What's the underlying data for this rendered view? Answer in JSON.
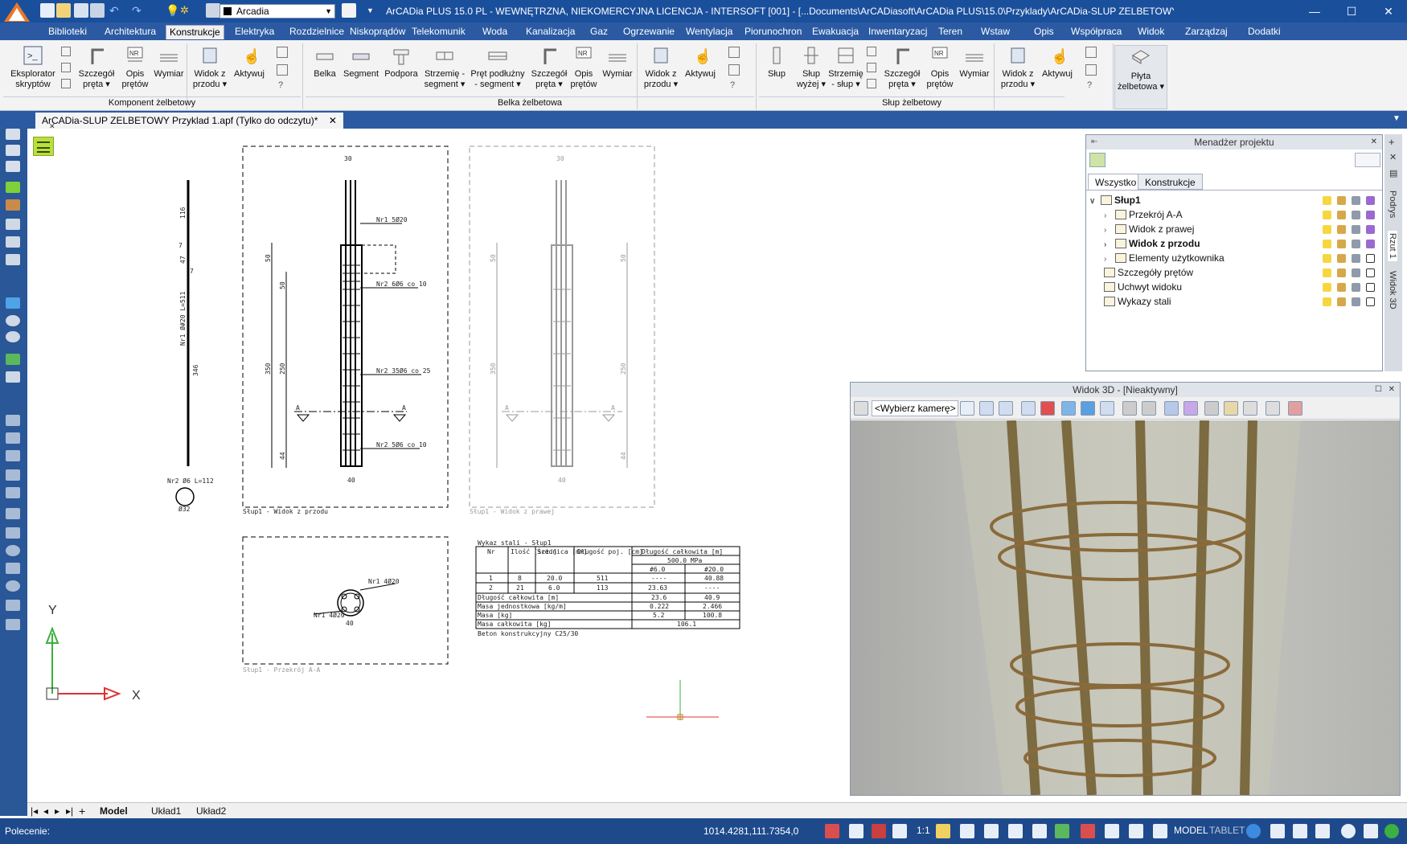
{
  "titlebar": {
    "title": "ArCADia PLUS 15.0 PL - WEWNĘTRZNA, NIEKOMERCYJNA LICENCJA - INTERSOFT [001] - [...Documents\\ArCADiasoft\\ArCADia PLUS\\15.0\\Przyklady\\ArCADia-SLUP ZELBETOWY Prz]",
    "font_name": "Arcadia",
    "minimize": "—",
    "maximize": "☐",
    "close": "✕"
  },
  "menu": [
    "Biblioteki",
    "Architektura",
    "Konstrukcje",
    "Elektryka",
    "Rozdzielnice",
    "Niskoprądów",
    "Telekomunik",
    "Woda",
    "Kanalizacja",
    "Gaz",
    "Ogrzewanie",
    "Wentylacja",
    "Piorunochron",
    "Ewakuacja",
    "Inwentaryzacj",
    "Teren",
    "Wstaw",
    "Opis",
    "Współpraca",
    "Widok",
    "Zarządzaj",
    "Dodatki"
  ],
  "ribbon": {
    "group1": {
      "title": "Komponent żelbetowy",
      "buttons": [
        [
          "Eksplorator",
          "skryptów"
        ],
        [
          "Szczegół",
          "pręta ▾"
        ],
        [
          "Opis",
          "prętów"
        ],
        [
          "Wymiar",
          ""
        ],
        [
          "Widok z",
          "przodu ▾"
        ],
        [
          "Aktywuj",
          ""
        ]
      ]
    },
    "group2": {
      "title": "Belka żelbetowa",
      "buttons": [
        [
          "Belka",
          ""
        ],
        [
          "Segment",
          ""
        ],
        [
          "Podpora",
          ""
        ],
        [
          "Strzemię -",
          "segment ▾"
        ],
        [
          "Pręt podłużny",
          "- segment ▾"
        ],
        [
          "Szczegół",
          "pręta ▾"
        ],
        [
          "Opis",
          "prętów"
        ],
        [
          "Wymiar",
          ""
        ],
        [
          "Widok z",
          "przodu ▾"
        ],
        [
          "Aktywuj",
          ""
        ]
      ]
    },
    "group3": {
      "title": "Słup żelbetowy",
      "buttons": [
        [
          "Słup",
          ""
        ],
        [
          "Słup",
          "wyżej ▾"
        ],
        [
          "Strzemię",
          "- słup ▾"
        ],
        [
          "Szczegół",
          "pręta ▾"
        ],
        [
          "Opis",
          "prętów"
        ],
        [
          "Wymiar",
          ""
        ],
        [
          "Widok z",
          "przodu ▾"
        ],
        [
          "Aktywuj",
          ""
        ]
      ]
    },
    "group4": {
      "buttons": [
        [
          "Płyta",
          "żelbetowa ▾"
        ]
      ]
    },
    "help": "?"
  },
  "doc_tab": "ArCADia-SLUP ZELBETOWY Przyklad 1.apf (Tylko do odczytu)*",
  "doc_close": "✕",
  "doc_add": "+",
  "project_manager": {
    "title": "Menadżer projektu",
    "close": "✕",
    "tabs": [
      "Wszystko",
      "Konstrukcje"
    ],
    "tree": [
      {
        "label": "Słup1",
        "level": 0,
        "bold": true,
        "arrow": "∨"
      },
      {
        "label": "Przekrój A-A",
        "level": 1,
        "bold": false,
        "arrow": "›"
      },
      {
        "label": "Widok z prawej",
        "level": 1,
        "bold": false,
        "arrow": "›"
      },
      {
        "label": "Widok z przodu",
        "level": 1,
        "bold": true,
        "arrow": "›"
      },
      {
        "label": "Elementy użytkownika",
        "level": 1,
        "bold": false,
        "arrow": "›"
      },
      {
        "label": "Szczegóły prętów",
        "level": 0,
        "bold": false,
        "arrow": ""
      },
      {
        "label": "Uchwyt widoku",
        "level": 0,
        "bold": false,
        "arrow": ""
      },
      {
        "label": "Wykazy stali",
        "level": 0,
        "bold": false,
        "arrow": ""
      }
    ]
  },
  "side_tabs": [
    "Podrys",
    "Rzut 1",
    "Widok 3D"
  ],
  "view3d": {
    "title": "Widok 3D - [Nieaktywny]",
    "camera": "<Wybierz kamerę>",
    "max": "☐",
    "close": "✕"
  },
  "drawing": {
    "front_view_caption": "Słup1 - Widok z przodu",
    "right_view_caption": "Słup1 - Widok z prawej",
    "section_caption": "Słup1 - Przekrój A-A",
    "bar1_label": "Nr1 5Ø20",
    "bar2a_label": "Nr2 6Ø6 co 10",
    "bar2b_label": "Nr2 35Ø6 co 25",
    "bar2c_label": "Nr2 5Ø6 co 10",
    "long_bar_label": "Nr1 Ø#20 L=511",
    "stirrup_label": "Nr2 Ø6 L=112",
    "stirrup_dim": "Ø32",
    "sec_bar1": "Nr1 4Ø20",
    "sec_bar2": "Nr1 4Ø20",
    "dim_30": "30",
    "dim_40": "40",
    "dim_50": "50",
    "dim_350": "350",
    "dim_250": "250",
    "dim_44": "44",
    "dim_116": "116",
    "dim_346": "346",
    "dim_47": "47",
    "dim_7a": "7",
    "dim_7b": "7",
    "section_A": "A",
    "axis_x": "X",
    "axis_y": "Y"
  },
  "steel_table": {
    "title": "Wykaz stali - Słup1",
    "headers": [
      "Nr",
      "Ilość [szt.]",
      "Średnica [mm]",
      "Długość poj. [cm]",
      "Długość całkowita [m]"
    ],
    "grade": "500.0 MPa",
    "diam_cols": [
      "#6.0",
      "#20.0"
    ],
    "rows": [
      [
        "1",
        "8",
        "20.0",
        "511",
        "----",
        "40.88"
      ],
      [
        "2",
        "21",
        "6.0",
        "113",
        "23.63",
        "----"
      ]
    ],
    "summary": [
      [
        "Długość całkowita [m]",
        "23.6",
        "40.9"
      ],
      [
        "Masa jednostkowa [kg/m]",
        "0.222",
        "2.466"
      ],
      [
        "Masa [kg]",
        "5.2",
        "100.8"
      ]
    ],
    "total_label": "Masa całkowita [kg]",
    "total_value": "106.1",
    "concrete": "Beton konstrukcyjny C25/30"
  },
  "sheet_tabs": [
    "Model",
    "Układ1",
    "Układ2"
  ],
  "status": {
    "command": "Polecenie:",
    "coords": "1014.4281,111.7354,0",
    "scale": "1:1",
    "model": "MODEL",
    "tablet": "TABLET"
  },
  "colors": {
    "title_bg": "#1a4f9c",
    "menu_bg": "#2b5aa3",
    "status_bg": "#1e4a8c",
    "bar_color": "#8a6a3a"
  }
}
